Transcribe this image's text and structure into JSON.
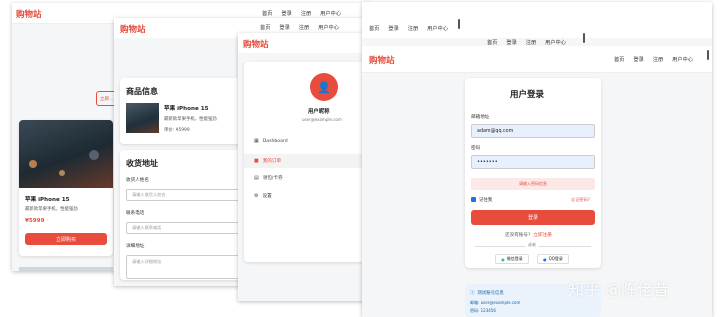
{
  "brand": "购物站",
  "nav": [
    "首页",
    "登录",
    "注册",
    "用户中心"
  ],
  "win1": {
    "partial_button": "立即...",
    "product": {
      "name": "苹果 iPhone 15",
      "desc": "最新款苹果手机，性能强劲",
      "price": "¥5999",
      "buy_label": "立即购买"
    }
  },
  "win2": {
    "product_section_title": "商品信息",
    "product": {
      "name": "苹果 iPhone 15",
      "desc": "最新款苹果手机，性能强劲",
      "price": "单价: ¥5999"
    },
    "address_title": "收货地址",
    "fields": [
      {
        "label": "收货人姓名",
        "placeholder": "请输入收货人姓名"
      },
      {
        "label": "联系电话",
        "placeholder": "请输入联系电话"
      },
      {
        "label": "详细地址",
        "placeholder": "请输入详细地址"
      }
    ]
  },
  "win3": {
    "nickname": "用户昵称",
    "email": "user@example.com",
    "menu": [
      {
        "icon": "dashboard-icon",
        "label": "Dashboard"
      },
      {
        "icon": "orders-icon",
        "label": "我的订单"
      },
      {
        "icon": "coupon-icon",
        "label": "领包/卡券"
      },
      {
        "icon": "settings-icon",
        "label": "设置"
      }
    ]
  },
  "win4": {
    "login_title": "用户登录",
    "email_label": "邮箱地址",
    "email_value": "adam@qq.com",
    "password_label": "密码",
    "password_value": "•••••••",
    "error_text": "请输入密码信息",
    "remember_label": "记住我",
    "forgot_label": "忘记密码?",
    "login_button": "登录",
    "no_account": "还没有账号?",
    "register_link": "立即注册",
    "or_text": "或者",
    "wechat_login": "微信登录",
    "qq_login": "QQ登录",
    "test_account_title": "测试账号信息",
    "test_email": "邮箱: user@example.com",
    "test_password": "密码: 123456"
  },
  "watermark": "知乎 @陈佬昔",
  "colors": {
    "accent": "#e74c3c",
    "input_bg": "#e8f0fe",
    "error_bg": "#fde8e8",
    "info_bg": "#eaf3fb"
  }
}
